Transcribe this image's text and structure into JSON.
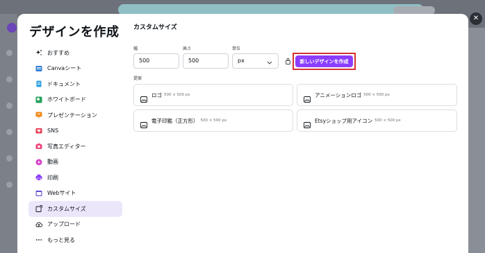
{
  "modal": {
    "title": "デザインを作成",
    "close_icon": "close-icon"
  },
  "nav": {
    "items": [
      {
        "label": "おすすめ",
        "icon": "sparkle-icon",
        "color": "#0e1318",
        "active": false
      },
      {
        "label": "Canvaシート",
        "icon": "sheet-icon",
        "color": "#2f7fd8",
        "active": false
      },
      {
        "label": "ドキュメント",
        "icon": "document-icon",
        "color": "#2aa0e0",
        "active": false
      },
      {
        "label": "ホワイトボード",
        "icon": "whiteboard-icon",
        "color": "#22a05a",
        "active": false
      },
      {
        "label": "プレゼンテーション",
        "icon": "presentation-icon",
        "color": "#f08a1c",
        "active": false
      },
      {
        "label": "SNS",
        "icon": "heart-icon",
        "color": "#e8384f",
        "active": false
      },
      {
        "label": "写真エディター",
        "icon": "camera-icon",
        "color": "#f0467a",
        "active": false
      },
      {
        "label": "動画",
        "icon": "video-icon",
        "color": "#d545c8",
        "active": false
      },
      {
        "label": "印刷",
        "icon": "printer-icon",
        "color": "#8b3dff",
        "active": false
      },
      {
        "label": "Webサイト",
        "icon": "website-icon",
        "color": "#5a4fd8",
        "active": false
      },
      {
        "label": "カスタムサイズ",
        "icon": "custom-size-icon",
        "color": "#0e1318",
        "active": true
      },
      {
        "label": "アップロード",
        "icon": "cloud-upload-icon",
        "color": "#0e1318",
        "active": false
      },
      {
        "label": "もっと見る",
        "icon": "more-icon",
        "color": "#0e1318",
        "active": false
      }
    ]
  },
  "custom": {
    "title": "カスタムサイズ",
    "width_label": "幅",
    "width_value": "500",
    "height_label": "高さ",
    "height_value": "500",
    "unit_label": "単位",
    "unit_value": "px",
    "create_button": "新しいデザインを作成",
    "suggest_label": "提案"
  },
  "suggestions": [
    {
      "name": "ロゴ",
      "size": "500 × 500 px"
    },
    {
      "name": "アニメーションロゴ",
      "size": "500 × 500 px"
    },
    {
      "name": "電子印鑑（正方形）",
      "size": "500 × 500 px"
    },
    {
      "name": "Etsyショップ用アイコン",
      "size": "500 × 500 px"
    }
  ],
  "colors": {
    "accent": "#8b3dff",
    "active_nav_bg": "#ece6fb",
    "highlight_border": "#d63030"
  }
}
